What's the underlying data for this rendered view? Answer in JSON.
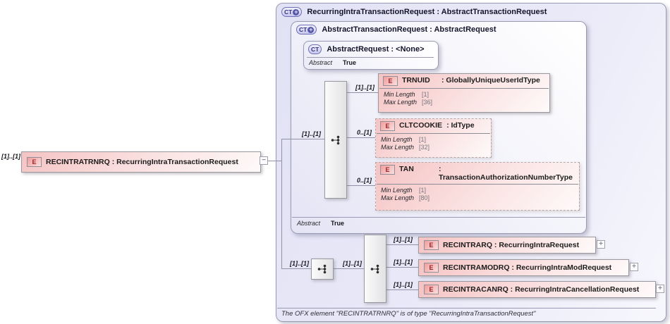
{
  "root": {
    "card": "[1]..[1]",
    "badge": "E",
    "title": "RECINTRATRNRQ : RecurringIntraTransactionRequest",
    "collapse_glyph": "−"
  },
  "outer": {
    "badge": "CT",
    "plus_glyph": "+",
    "title": "RecurringIntraTransactionRequest : AbstractTransactionRequest",
    "footer": "The OFX element \"RECINTRATRNRQ\" is of type \"RecurringIntraTransactionRequest\""
  },
  "inner": {
    "badge": "CT",
    "plus_glyph": "+",
    "title": "AbstractTransactionRequest : AbstractRequest",
    "seq_card": "[1]..[1]",
    "abstract_label": "Abstract",
    "abstract_value": "True"
  },
  "base": {
    "badge": "CT",
    "title": "AbstractRequest : <None>",
    "abstract_label": "Abstract",
    "abstract_value": "True"
  },
  "trnuid": {
    "card": "[1]..[1]",
    "badge": "E",
    "name": "TRNUID",
    "type": ": GloballyUniqueUserIdType",
    "facets": [
      {
        "label": "Min Length",
        "value": "[1]"
      },
      {
        "label": "Max Length",
        "value": "[36]"
      }
    ]
  },
  "cltcookie": {
    "card": "0..[1]",
    "badge": "E",
    "name": "CLTCOOKIE",
    "type": ": IdType",
    "facets": [
      {
        "label": "Min Length",
        "value": "[1]"
      },
      {
        "label": "Max Length",
        "value": "[32]"
      }
    ]
  },
  "tan": {
    "card": "0..[1]",
    "badge": "E",
    "name": "TAN",
    "type": ": TransactionAuthorizationNumberType",
    "facets": [
      {
        "label": "Min Length",
        "value": "[1]"
      },
      {
        "label": "Max Length",
        "value": "[80]"
      }
    ]
  },
  "bottom": {
    "seq_card": "[1]..[1]",
    "choice_card": "[1]..[1]",
    "children": [
      {
        "card": "[1]..[1]",
        "badge": "E",
        "title": "RECINTRARQ : RecurringIntraRequest",
        "expand_glyph": "+"
      },
      {
        "card": "[1]..[1]",
        "badge": "E",
        "title": "RECINTRAMODRQ : RecurringIntraModRequest",
        "expand_glyph": "+"
      },
      {
        "card": "[1]..[1]",
        "badge": "E",
        "title": "RECINTRACANRQ : RecurringIntraCancellationRequest",
        "expand_glyph": "+"
      }
    ]
  }
}
